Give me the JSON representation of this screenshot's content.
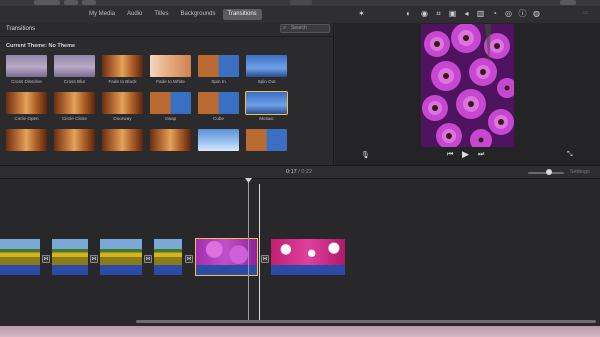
{
  "tabs": [
    "My Media",
    "Audio",
    "Titles",
    "Backgrounds",
    "Transitions"
  ],
  "active_tab": "Transitions",
  "browser": {
    "title": "Transitions",
    "search_placeholder": "Search",
    "theme_label": "Current Theme: No Theme",
    "transitions": [
      {
        "label": "Cross Dissolve",
        "style": "t-lav"
      },
      {
        "label": "Cross Blur",
        "style": "t-lav"
      },
      {
        "label": "Fade to Black",
        "style": "t-canyon"
      },
      {
        "label": "Fade to White",
        "style": "t-white"
      },
      {
        "label": "Spin In",
        "style": "t-split"
      },
      {
        "label": "Spin Out",
        "style": "t-blue"
      },
      {
        "label": "Circle Open",
        "style": "t-canyon"
      },
      {
        "label": "Circle Close",
        "style": "t-canyon"
      },
      {
        "label": "Doorway",
        "style": "t-canyon"
      },
      {
        "label": "Swap",
        "style": "t-split"
      },
      {
        "label": "Cube",
        "style": "t-split"
      },
      {
        "label": "Mosaic",
        "style": "t-blue",
        "selected": true
      },
      {
        "label": "",
        "style": "t-canyon"
      },
      {
        "label": "",
        "style": "t-canyon"
      },
      {
        "label": "",
        "style": "t-canyon"
      },
      {
        "label": "",
        "style": "t-canyon"
      },
      {
        "label": "",
        "style": "t-sky"
      },
      {
        "label": "",
        "style": "t-split"
      }
    ]
  },
  "timeline": {
    "current_time": "0:17",
    "total_time": "0:22",
    "settings_label": "Settings"
  },
  "colors": {
    "accent": "#f0c040",
    "audio": "#2c4aa8"
  }
}
